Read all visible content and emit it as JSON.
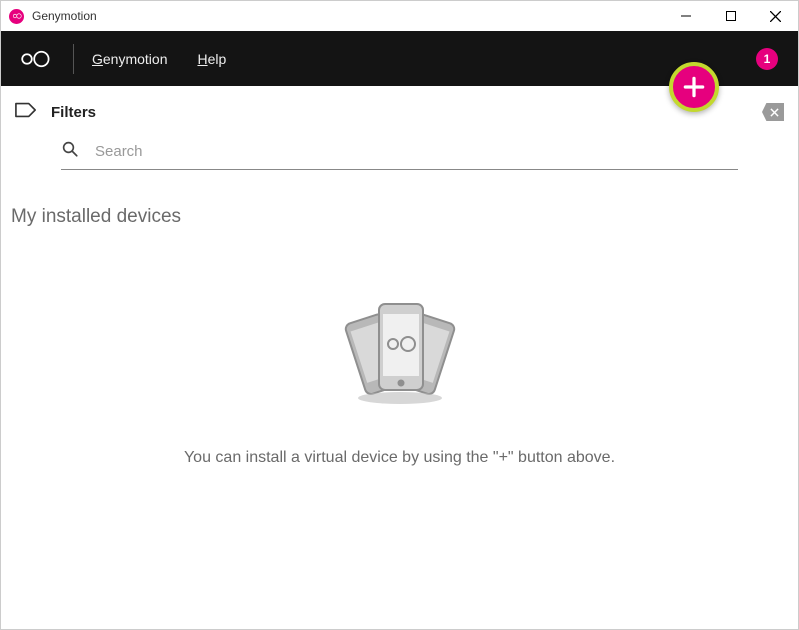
{
  "window": {
    "title": "Genymotion"
  },
  "menubar": {
    "items": [
      {
        "label": "Genymotion",
        "underline_first": true
      },
      {
        "label": "Help",
        "underline_first": true
      }
    ],
    "notification_count": "1"
  },
  "filters": {
    "label": "Filters"
  },
  "search": {
    "placeholder": "Search",
    "value": ""
  },
  "section": {
    "title": "My installed devices"
  },
  "empty_state": {
    "message": "You can install a virtual device by using the \"+\" button above."
  },
  "colors": {
    "brand_pink": "#e6007e",
    "fab_ring": "#c3d82e"
  }
}
